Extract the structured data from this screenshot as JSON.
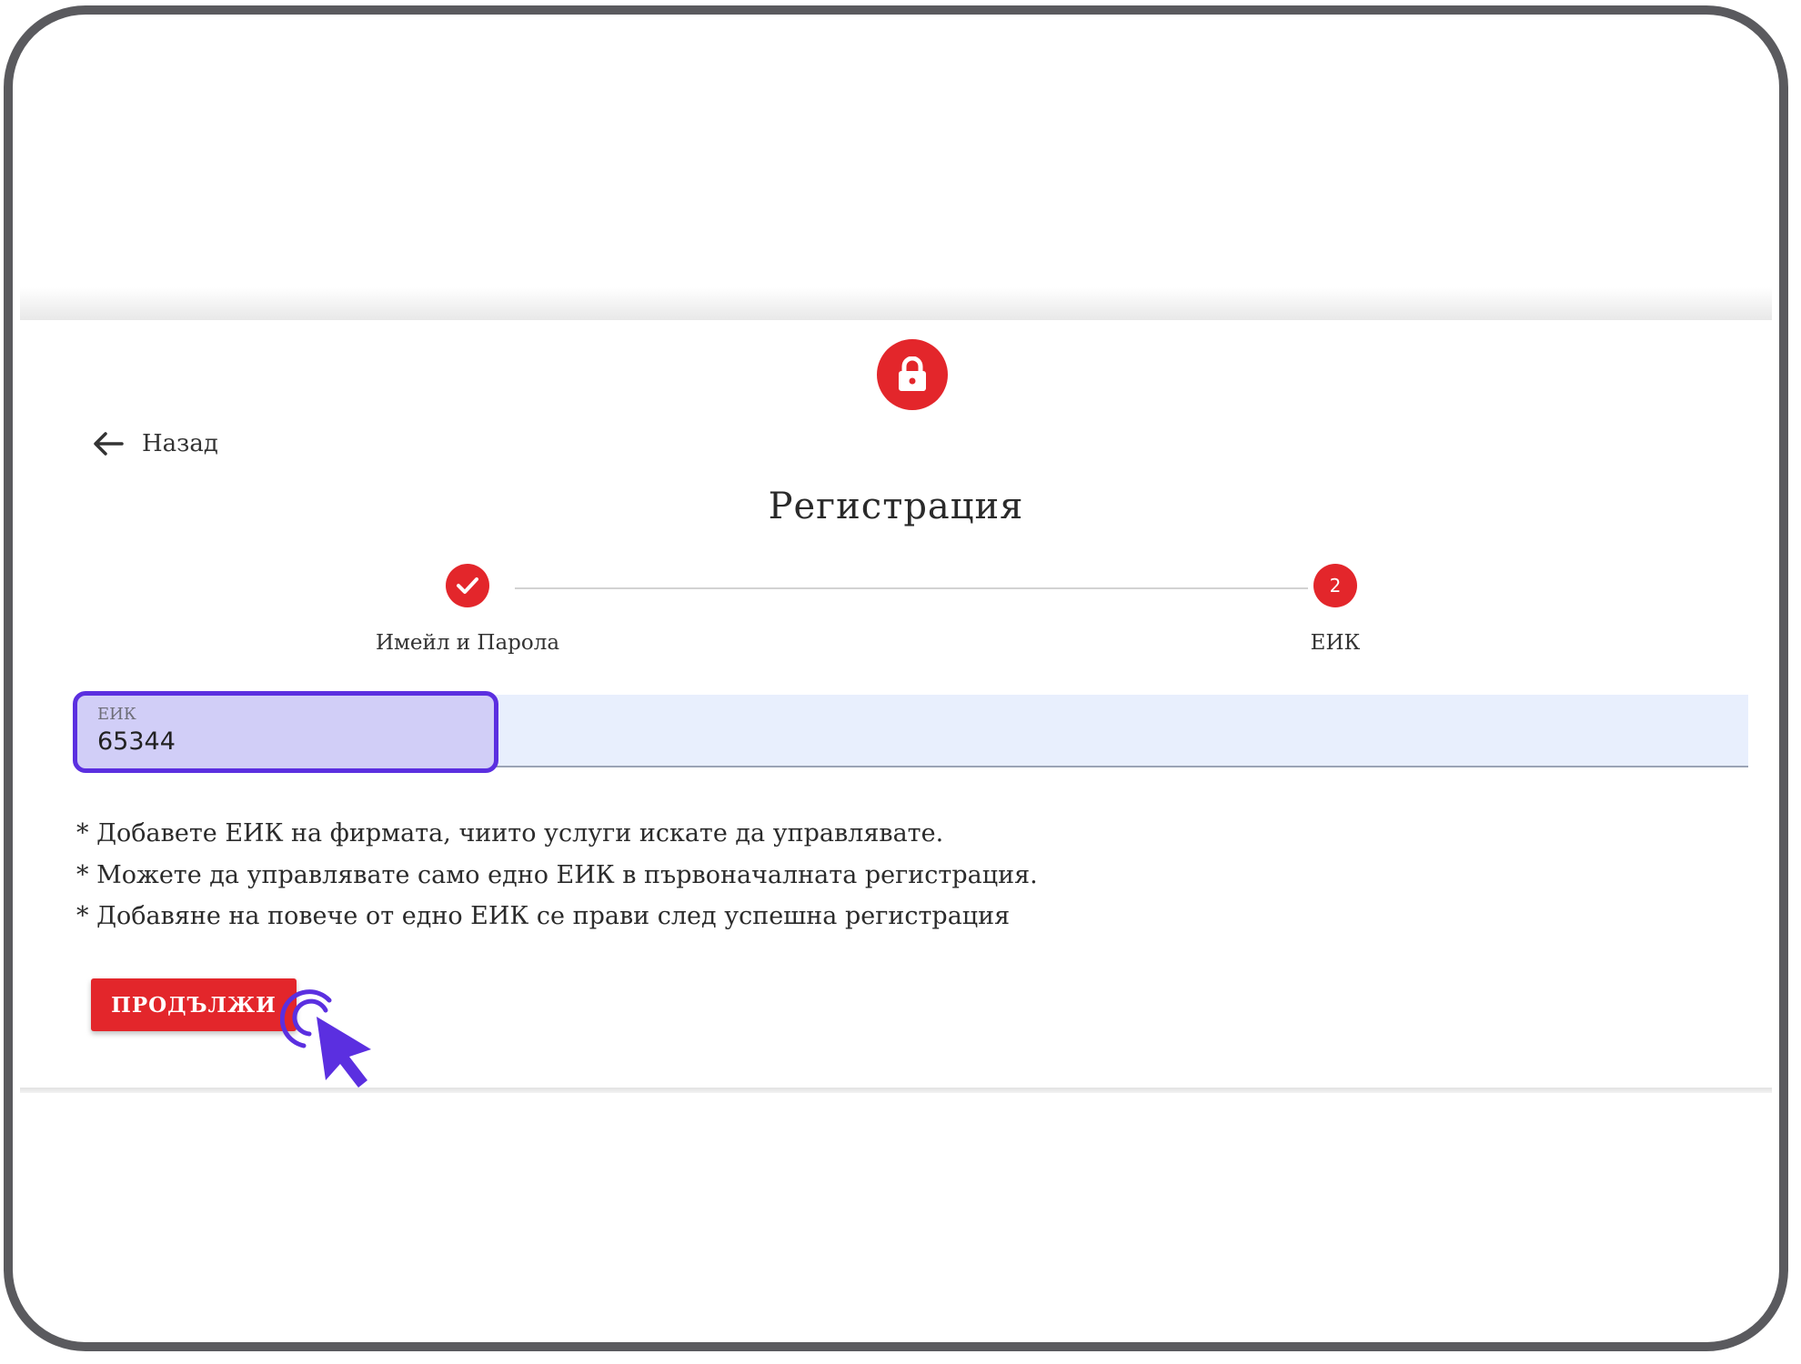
{
  "nav": {
    "back_label": "Назад"
  },
  "page": {
    "title": "Регистрация"
  },
  "stepper": {
    "steps": [
      {
        "label": "Имейл и Парола",
        "status": "completed"
      },
      {
        "label": "ЕИК",
        "number": "2",
        "status": "active"
      }
    ]
  },
  "form": {
    "eik_label": "ЕИК",
    "eik_value": "65344"
  },
  "notes": [
    "* Добавете ЕИК на фирмата, чиито услуги искате да управлявате.",
    "* Можете да управлявате само едно ЕИК в първоначалната регистрация.",
    "* Добавяне на повече от едно ЕИК се прави след успешна регистрация"
  ],
  "actions": {
    "continue_label": "ПРОДЪЛЖИ"
  },
  "colors": {
    "accent": "#e3262b",
    "highlight": "#5b2fe0",
    "field_bg": "#e8effd"
  }
}
